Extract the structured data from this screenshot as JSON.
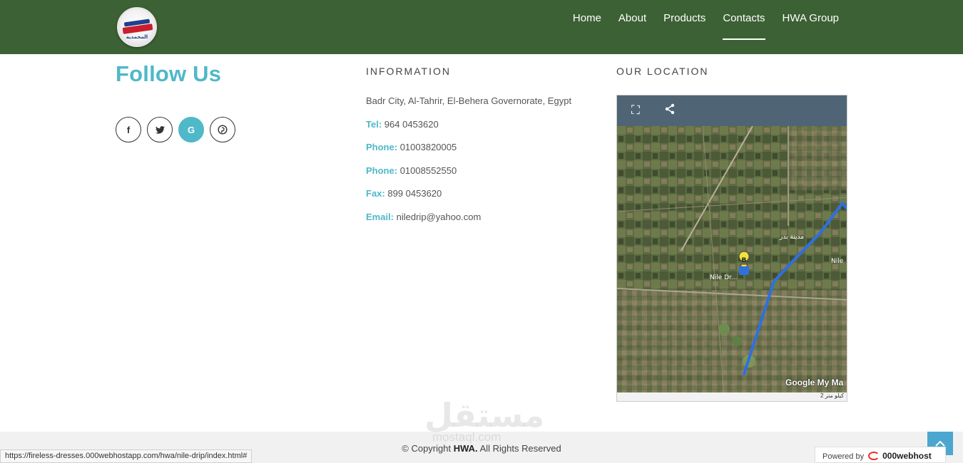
{
  "header": {
    "nav": [
      "Home",
      "About",
      "Products",
      "Contacts",
      "HWA Group"
    ],
    "active": "Contacts",
    "bg_color": "#3c6134"
  },
  "follow": {
    "title": "Follow Us",
    "socials": [
      {
        "icon": "facebook-icon",
        "glyph": "f"
      },
      {
        "icon": "twitter-icon",
        "glyph": "t"
      },
      {
        "icon": "google-icon",
        "glyph": "G"
      },
      {
        "icon": "pinterest-icon",
        "glyph": "p"
      }
    ]
  },
  "information": {
    "title": "INFORMATION",
    "address": "Badr City, Al-Tahrir, El-Behera Governorate, Egypt",
    "tel_label": "Tel:",
    "tel": "964 0453620",
    "phone1_label": "Phone:",
    "phone1": "01003820005",
    "phone2_label": "Phone:",
    "phone2": "01008552550",
    "fax_label": "Fax:",
    "fax": "899 0453620",
    "email_label": "Email:",
    "email": "niledrip@yahoo.com"
  },
  "location": {
    "title": "OUR LOCATION",
    "marker_label": "B",
    "place_label": "Nile Dr...",
    "google_label": "Google My Ma",
    "scale_label": "2 كيلو متر"
  },
  "footer": {
    "copyright_prefix": "© Copyright",
    "brand": "HWA.",
    "copyright_suffix": "All Rights Reserved",
    "status_url": "https://fireless-dresses.000webhostapp.com/hwa/nile-drip/index.html#",
    "powered_label": "Powered by",
    "powered_brand": "000webhost",
    "watermark": "مستقل",
    "watermark_sub": "mostaql.com"
  },
  "accent_color": "#4fb8c9"
}
